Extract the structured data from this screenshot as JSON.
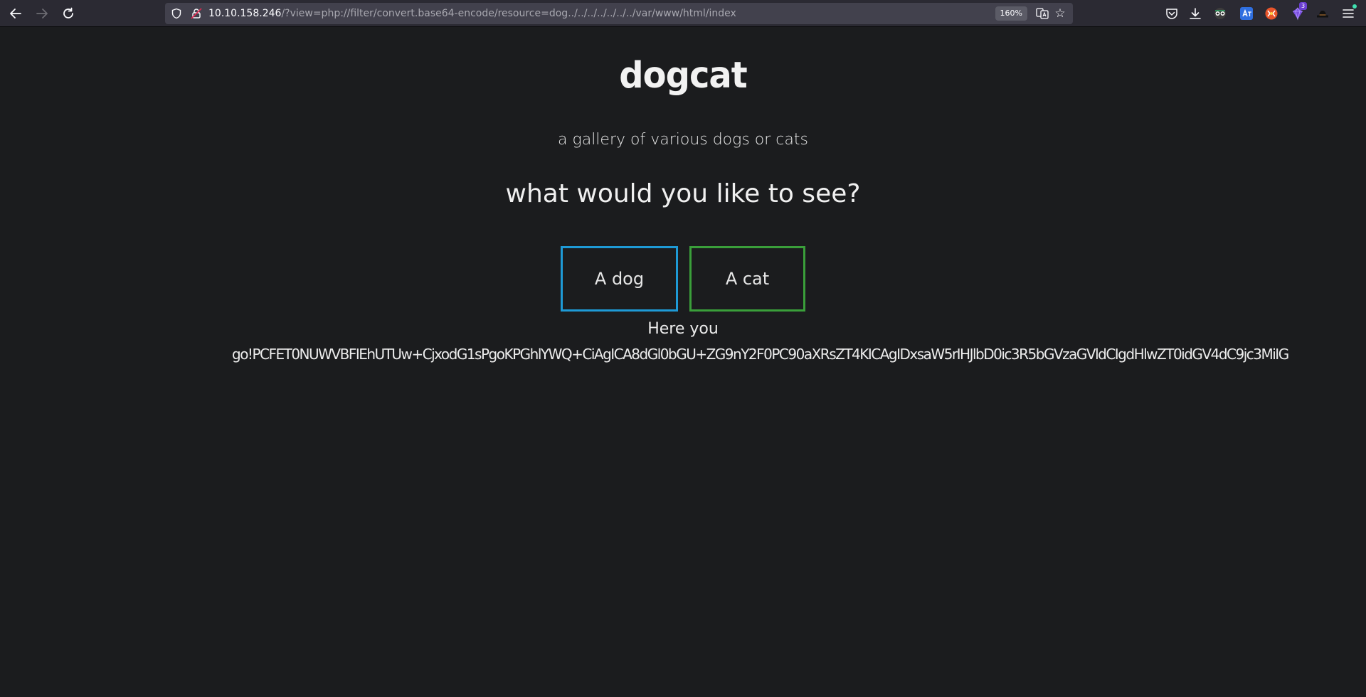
{
  "browser": {
    "url_host": "10.10.158.246",
    "url_path": "/?view=php://filter/convert.base64-encode/resource=dog../../../../../../../var/www/html/index",
    "zoom_level": "160%",
    "extension_badge_count": "3",
    "icons": {
      "back": "back-arrow-icon",
      "forward": "forward-arrow-icon",
      "reload": "reload-icon",
      "shield": "tracking-shield-icon",
      "lock": "insecure-lock-icon",
      "translate": "translate-icon",
      "bookmark": "star-icon",
      "pocket": "pocket-icon",
      "downloads": "download-icon",
      "menu": "hamburger-menu-icon"
    }
  },
  "page": {
    "title": "dogcat",
    "subtitle": "a gallery of various dogs or cats",
    "question": "what would you like to see?",
    "buttons": {
      "dog": "A dog",
      "cat": "A cat"
    },
    "result_label": "Here you",
    "result_data": "go!PCFET0NUWVBFIEhUTUw+CjxodG1sPgoKPGhlYWQ+CiAgICA8dGl0bGU+ZG9nY2F0PC90aXRsZT4KICAgIDxsaW5rIHJlbD0ic3R5bGVzaGVldCIgdHlwZT0idGV4dC9jc3MiIG"
  },
  "colors": {
    "page_background": "#1b1c1e",
    "dog_button_border": "#1e9ad6",
    "cat_button_border": "#3a9f3a",
    "toolbar_background": "#2b2a33",
    "urlbar_background": "#42414d"
  }
}
